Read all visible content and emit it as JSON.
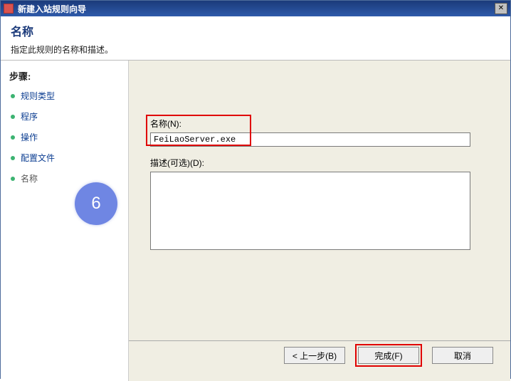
{
  "window": {
    "title": "新建入站规则向导",
    "close_glyph": "✕"
  },
  "header": {
    "title": "名称",
    "subtitle": "指定此规则的名称和描述。"
  },
  "sidebar": {
    "header": "步骤:",
    "items": [
      {
        "label": "规则类型"
      },
      {
        "label": "程序"
      },
      {
        "label": "操作"
      },
      {
        "label": "配置文件"
      },
      {
        "label": "名称"
      }
    ],
    "current_index": 4
  },
  "form": {
    "name_label": "名称(N):",
    "name_value": "FeiLaoServer.exe",
    "desc_label": "描述(可选)(D):",
    "desc_value": ""
  },
  "buttons": {
    "back": "< 上一步(B)",
    "finish": "完成(F)",
    "cancel": "取消"
  },
  "annotation": {
    "badge": "6"
  }
}
